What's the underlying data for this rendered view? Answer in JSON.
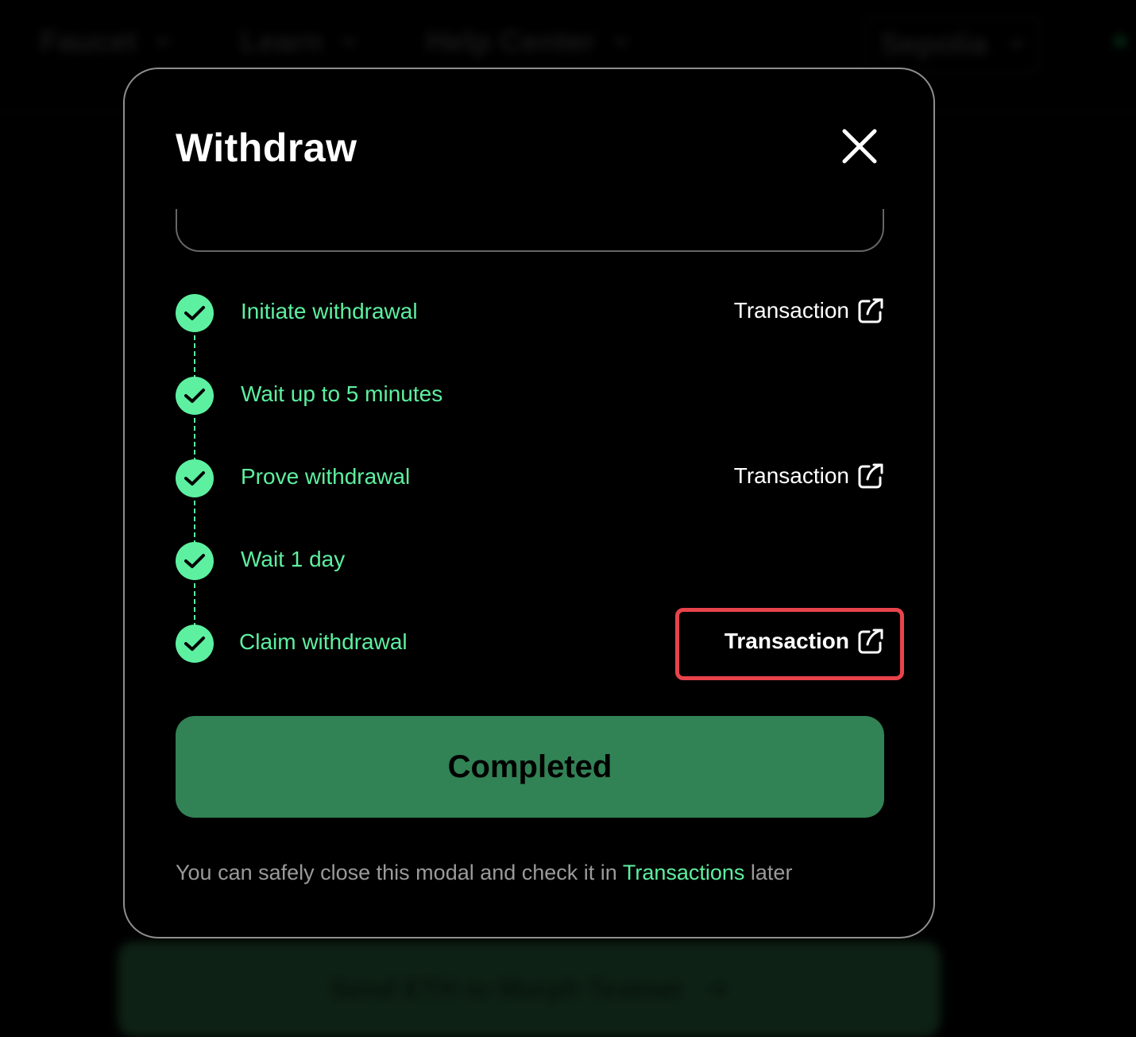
{
  "background": {
    "nav_items": [
      "Faucet",
      "Learn",
      "Help Center"
    ],
    "network": "Sepolia",
    "cta_label": "Send ETH to Morph Testnet"
  },
  "modal": {
    "title": "Withdraw",
    "steps": [
      {
        "label": "Initiate withdrawal",
        "link": "Transaction"
      },
      {
        "label": "Wait up to 5 minutes"
      },
      {
        "label": "Prove withdrawal",
        "link": "Transaction"
      },
      {
        "label": "Wait 1 day"
      },
      {
        "label": "Claim withdrawal",
        "link": "Transaction"
      }
    ],
    "status_button": "Completed",
    "footer": {
      "before": "You can safely close this modal and check it in ",
      "link": "Transactions",
      "after": " later"
    }
  },
  "colors": {
    "accent": "#5df0a0",
    "button": "#318254",
    "highlight": "#e8434b"
  }
}
